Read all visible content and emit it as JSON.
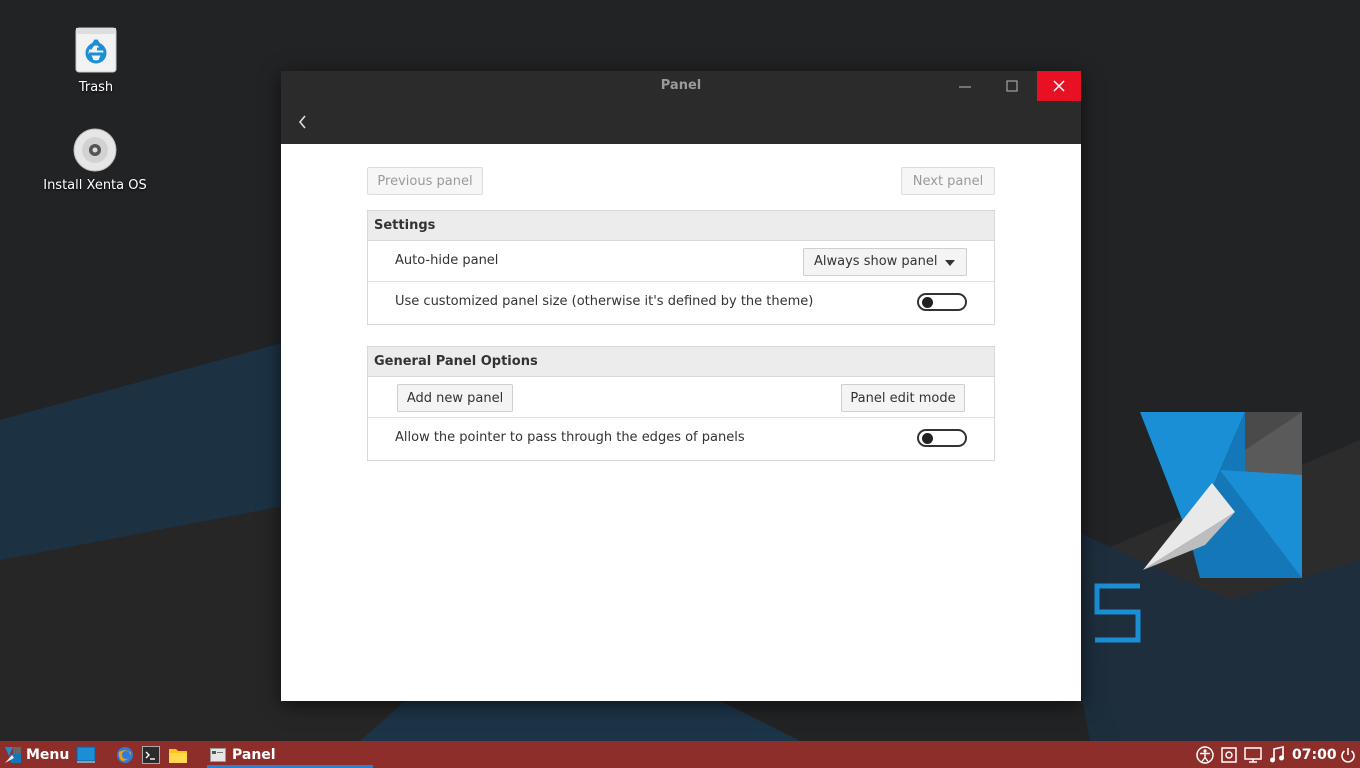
{
  "desktop": {
    "icons": [
      {
        "label": "Trash"
      },
      {
        "label": "Install Xenta OS"
      }
    ]
  },
  "window": {
    "title": "Panel",
    "buttons": {
      "previous_panel": "Previous panel",
      "next_panel": "Next panel"
    },
    "sections": [
      {
        "title": "Settings",
        "rows": [
          {
            "label": "Auto-hide panel",
            "control": "combo",
            "value": "Always show panel"
          },
          {
            "label": "Use customized panel size (otherwise it's defined by the theme)",
            "control": "toggle",
            "on": false
          }
        ]
      },
      {
        "title": "General Panel Options",
        "rows": [
          {
            "buttons": [
              "Add new panel",
              "Panel edit mode"
            ]
          },
          {
            "label": "Allow the pointer to pass through the edges of panels",
            "control": "toggle",
            "on": false
          }
        ]
      }
    ]
  },
  "taskbar": {
    "menu_label": "Menu",
    "task_label": "Panel",
    "clock": "07:00",
    "launchers": [
      "desktop-icon",
      "browser-icon",
      "terminal-icon",
      "files-icon"
    ],
    "tray": [
      "accessibility-icon",
      "system-monitor-icon",
      "network-icon",
      "music-icon",
      "power-icon"
    ]
  },
  "colors": {
    "taskbar": "#8e2e2b",
    "close": "#e81123",
    "accent": "#1a8fd6"
  }
}
